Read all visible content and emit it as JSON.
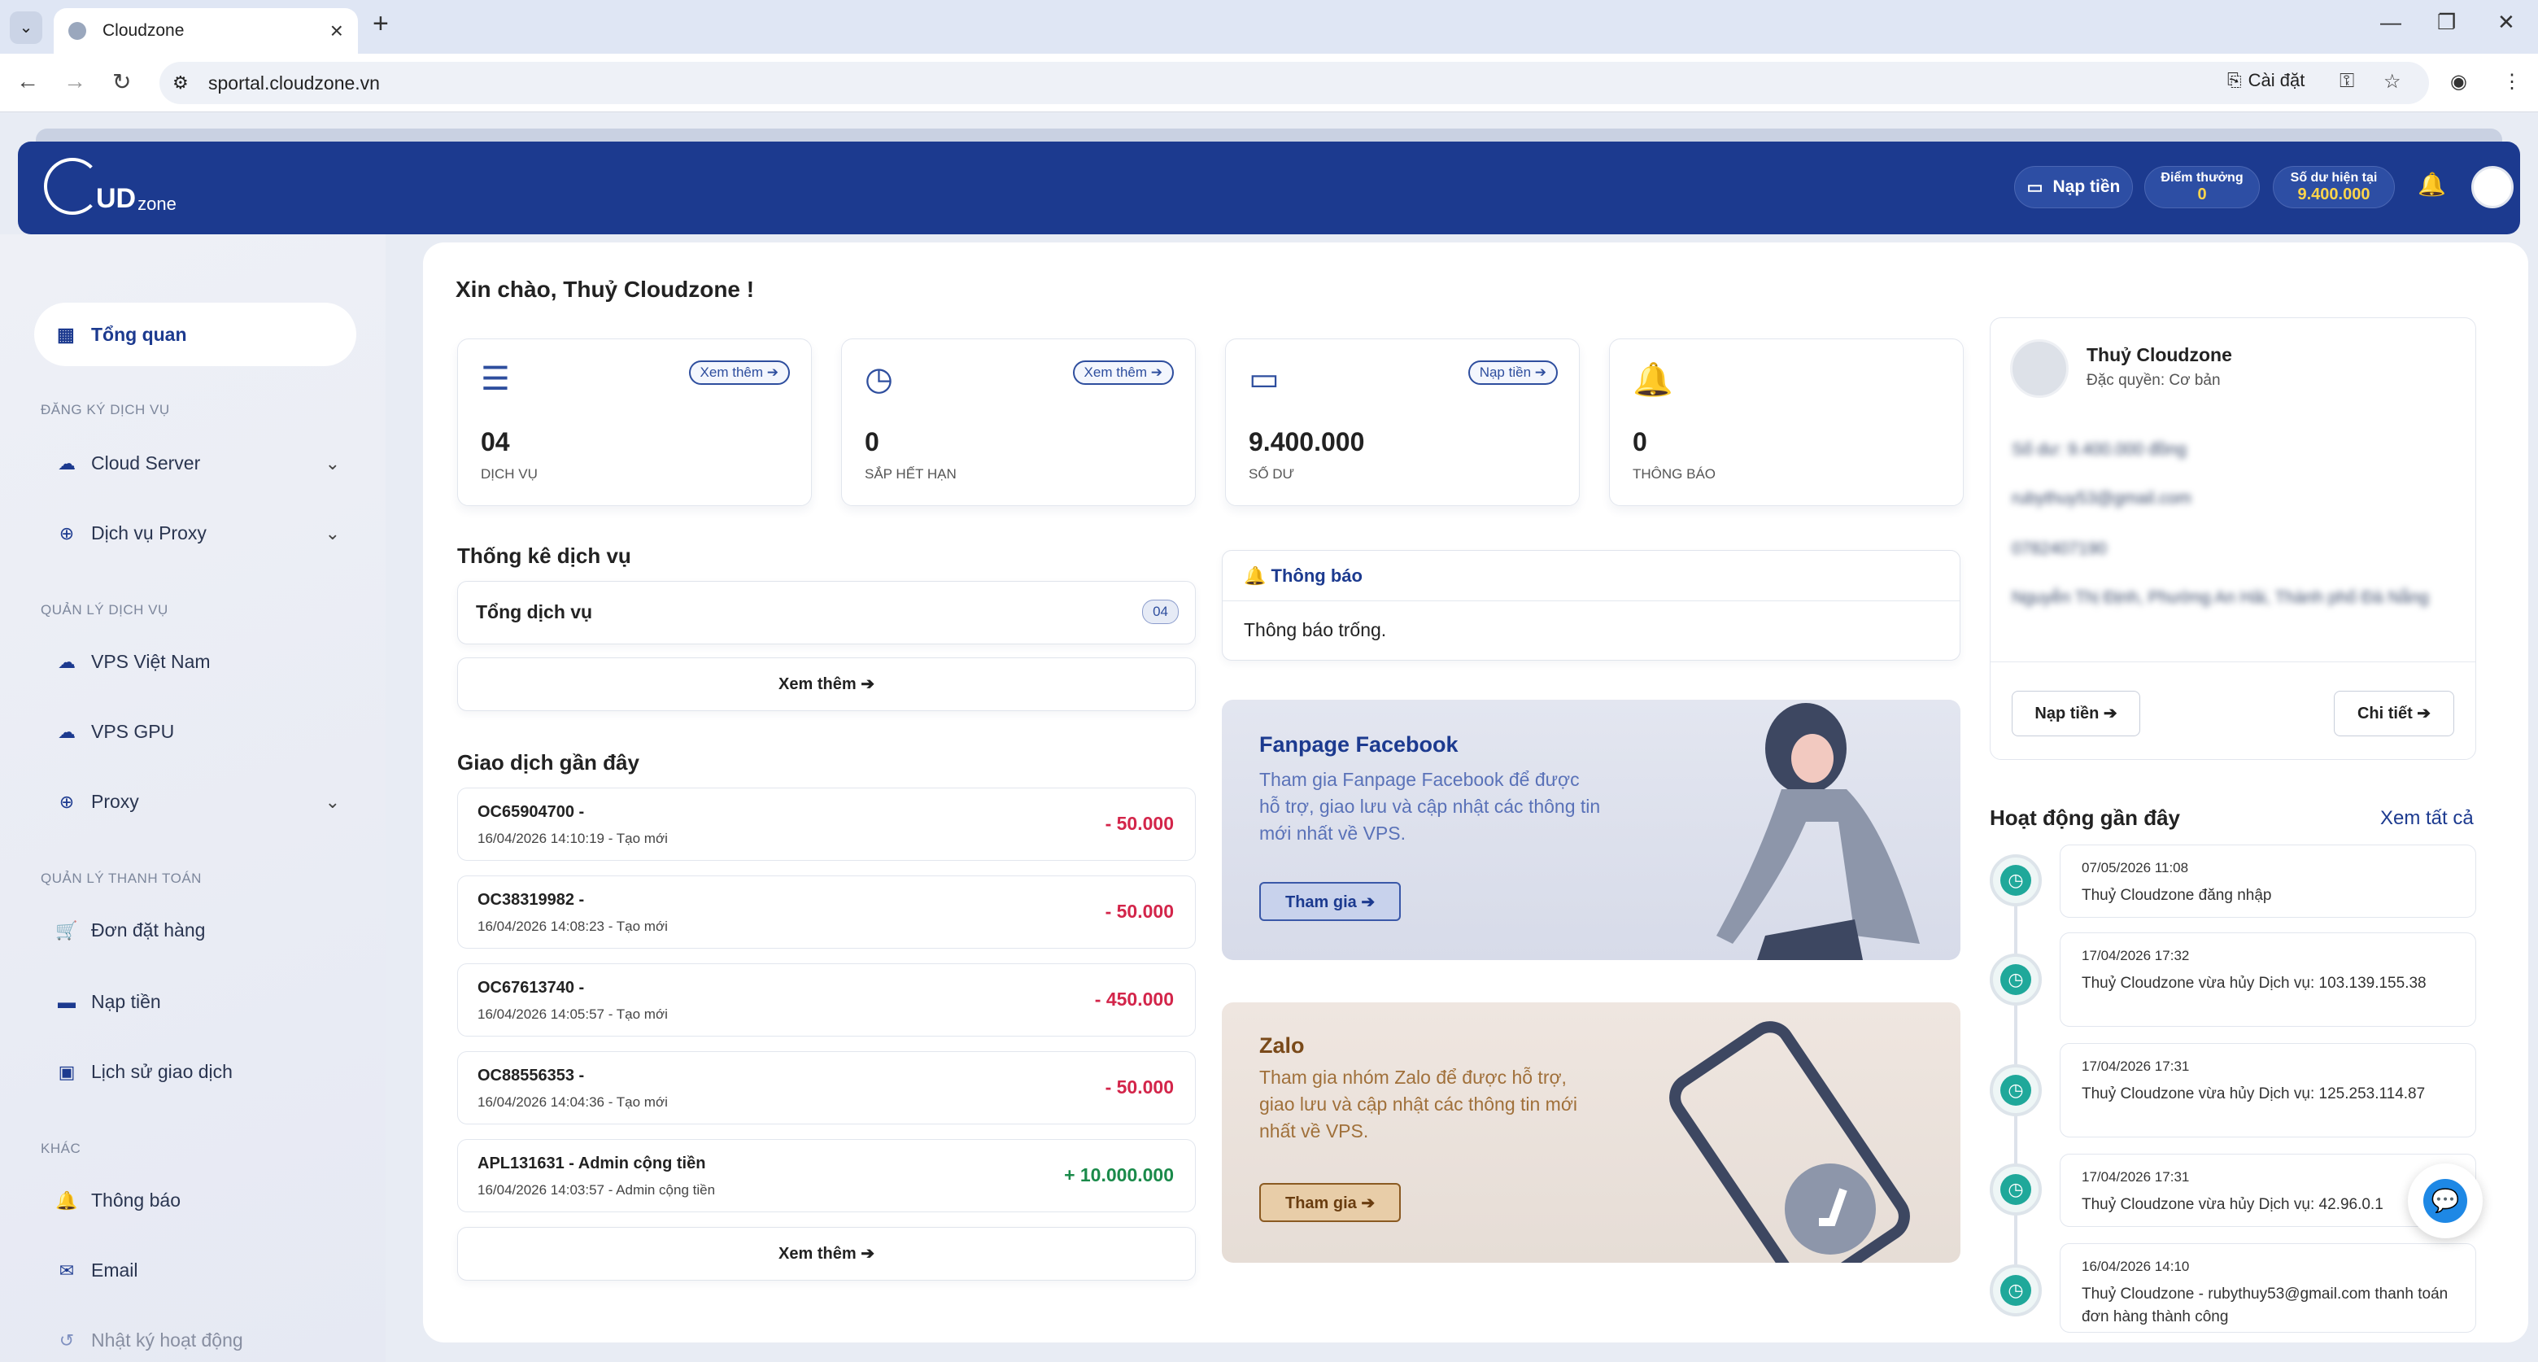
{
  "browser": {
    "tab_title": "Cloudzone",
    "url": "sportal.cloudzone.vn",
    "install_label": "Cài đặt"
  },
  "header": {
    "logo_text": "UD",
    "logo_small": "zone",
    "naptien_label": "Nạp tiền",
    "points_label": "Điểm thưởng",
    "points_value": "0",
    "balance_label": "Số dư hiện tại",
    "balance_value": "9.400.000"
  },
  "sidebar": {
    "active": "Tổng quan",
    "sections": [
      "ĐĂNG KÝ DỊCH VỤ",
      "QUẢN LÝ DỊCH VỤ",
      "QUẢN LÝ THANH TOÁN",
      "KHÁC"
    ],
    "items": [
      "Cloud Server",
      "Dịch vụ Proxy",
      "VPS Việt Nam",
      "VPS GPU",
      "Proxy",
      "Đơn đặt hàng",
      "Nạp tiền",
      "Lịch sử giao dịch",
      "Thông báo",
      "Email",
      "Nhật ký hoạt động"
    ]
  },
  "main": {
    "greeting": "Xin chào, Thuỷ Cloudzone !",
    "cards": [
      {
        "pill": "Xem thêm ➔",
        "value": "04",
        "label": "DỊCH VỤ"
      },
      {
        "pill": "Xem thêm ➔",
        "value": "0",
        "label": "SẮP HẾT HẠN"
      },
      {
        "pill": "Nạp tiền ➔",
        "value": "9.400.000",
        "label": "SỐ DƯ"
      },
      {
        "pill": "",
        "value": "0",
        "label": "THÔNG BÁO"
      }
    ],
    "stats_title": "Thống kê dịch vụ",
    "total_label": "Tổng dịch vụ",
    "total_badge": "04",
    "see_more": "Xem thêm ➔",
    "tx_title": "Giao dịch gần đây",
    "transactions": [
      {
        "id": "OC65904700 -",
        "date": "16/04/2026 14:10:19 - Tạo mới",
        "amount": "- 50.000"
      },
      {
        "id": "OC38319982 -",
        "date": "16/04/2026 14:08:23 - Tạo mới",
        "amount": "- 50.000"
      },
      {
        "id": "OC67613740 -",
        "date": "16/04/2026 14:05:57 - Tạo mới",
        "amount": "- 450.000"
      },
      {
        "id": "OC88556353 -",
        "date": "16/04/2026 14:04:36 - Tạo mới",
        "amount": "- 50.000"
      },
      {
        "id": "APL131631 - Admin cộng tiền",
        "date": "16/04/2026 14:03:57 - Admin cộng tiền",
        "amount": "+ 10.000.000"
      }
    ],
    "notify_title": "Thông báo",
    "notify_empty": "Thông báo trống.",
    "fb_title": "Fanpage Facebook",
    "fb_desc": "Tham gia Fanpage Facebook để được hỗ trợ, giao lưu và cập nhật các thông tin mới nhất về VPS.",
    "fb_btn": "Tham gia ➔",
    "zalo_title": "Zalo",
    "zalo_desc": "Tham gia nhóm Zalo để được hỗ trợ, giao lưu và cập nhật các thông tin mới nhất về VPS.",
    "zalo_btn": "Tham gia ➔"
  },
  "profile": {
    "name": "Thuỷ Cloudzone",
    "tier": "Đặc quyền: Cơ bản",
    "blur_lines": [
      "Số dư: 9.400.000 đồng",
      "rubythuy53@gmail.com",
      "0782407190",
      "Nguyễn Thị Định, Phường An Hải, Thành phố Đà Nẵng"
    ],
    "naptien_btn": "Nạp tiền ➔",
    "detail_btn": "Chi tiết ➔"
  },
  "activity": {
    "title": "Hoạt động gần đây",
    "view_all": "Xem tất cả",
    "items": [
      {
        "date": "07/05/2026 11:08",
        "text": "Thuỷ Cloudzone đăng nhập"
      },
      {
        "date": "17/04/2026 17:32",
        "text": "Thuỷ Cloudzone vừa hủy Dịch vụ: 103.139.155.38"
      },
      {
        "date": "17/04/2026 17:31",
        "text": "Thuỷ Cloudzone vừa hủy Dịch vụ: 125.253.114.87"
      },
      {
        "date": "17/04/2026 17:31",
        "text": "Thuỷ Cloudzone vừa hủy Dịch vụ: 42.96.0.1"
      },
      {
        "date": "16/04/2026 14:10",
        "text": "Thuỷ Cloudzone - rubythuy53@gmail.com thanh toán đơn hàng thành công"
      }
    ]
  }
}
